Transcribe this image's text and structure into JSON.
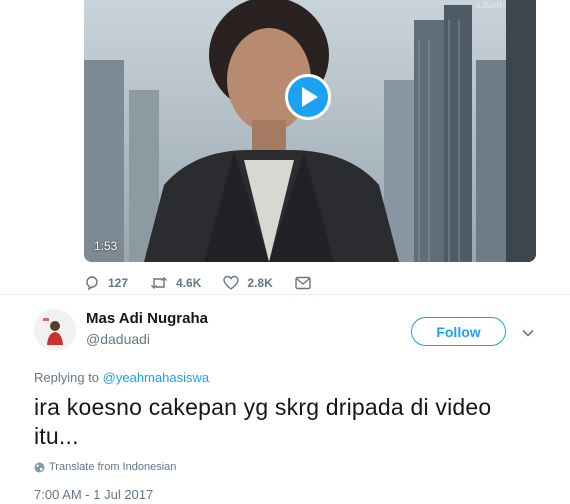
{
  "video": {
    "duration": "1:53",
    "channel_logo": "s.tium"
  },
  "actions": {
    "replies": "127",
    "retweets": "4.6K",
    "likes": "2.8K"
  },
  "reply": {
    "display_name": "Mas Adi Nugraha",
    "handle": "@daduadi",
    "follow_label": "Follow",
    "replying_prefix": "Replying to",
    "replying_to": "@yeahmahasiswa",
    "text": "ira koesno cakepan yg skrg dripada di video itu...",
    "translate_label": "Translate from Indonesian",
    "timestamp": "7:00 AM - 1 Jul 2017"
  },
  "colors": {
    "accent": "#1da1f2",
    "muted": "#657786",
    "text": "#14171a"
  },
  "icons": [
    "play-icon",
    "reply-icon",
    "retweet-icon",
    "like-icon",
    "dm-icon",
    "chevron-down-icon",
    "globe-icon"
  ]
}
